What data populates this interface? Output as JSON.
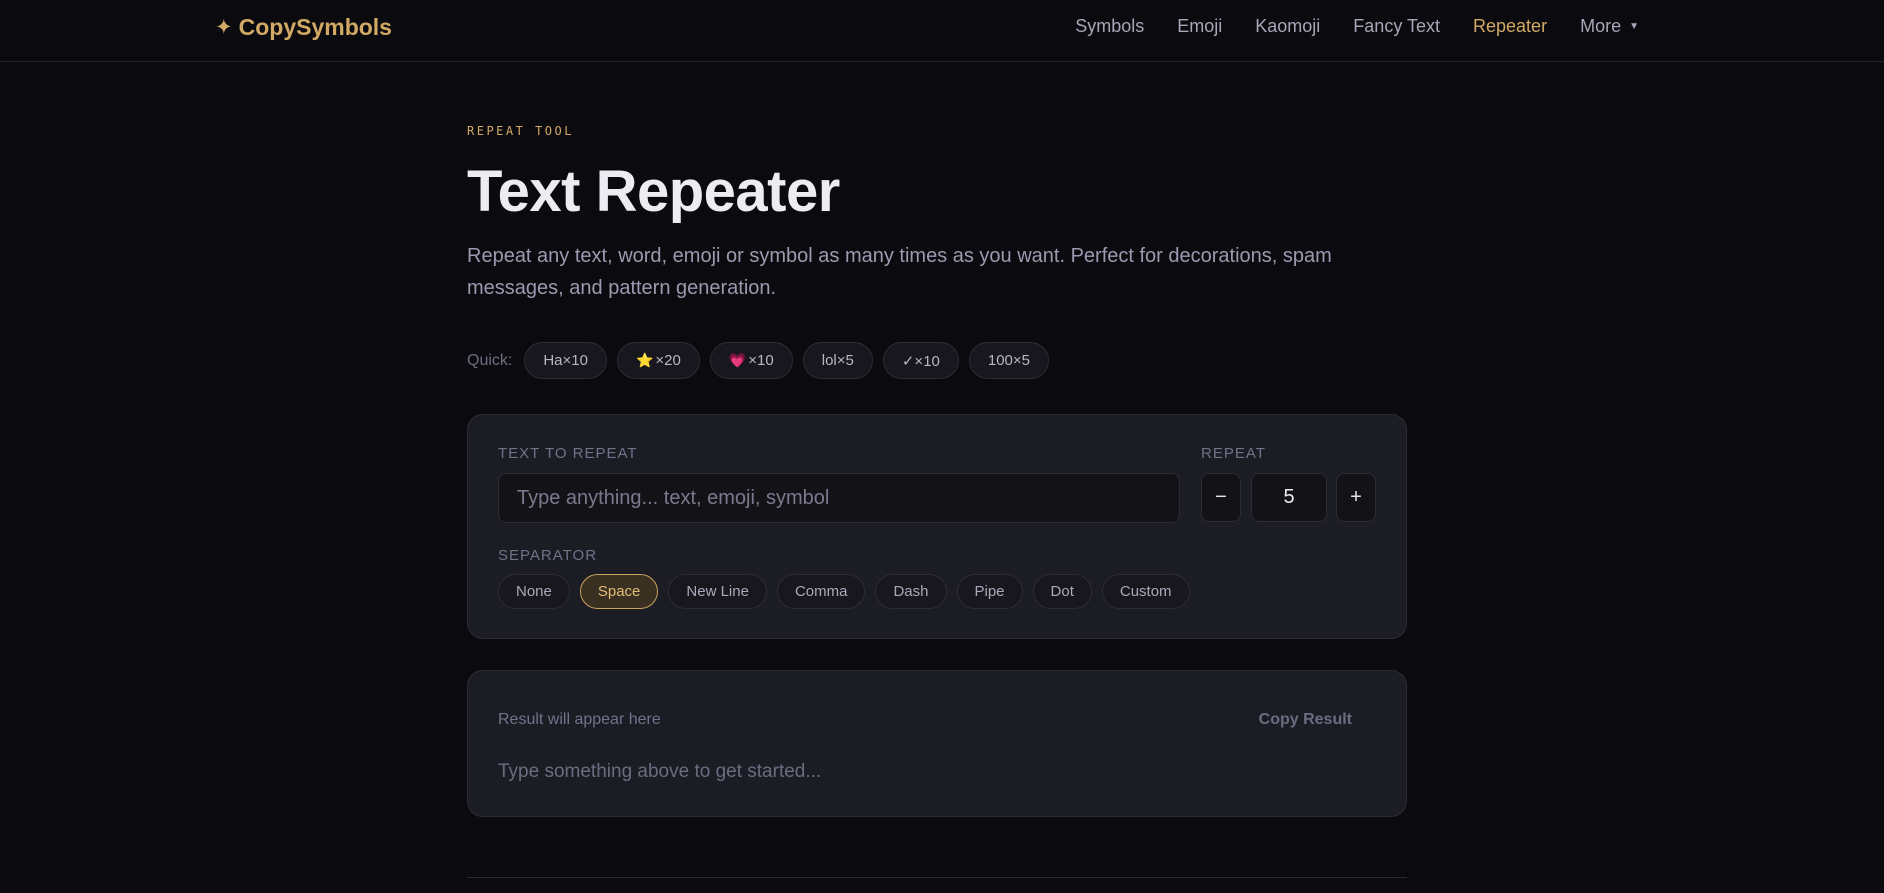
{
  "brand": {
    "star": "✦",
    "name": "CopySymbols"
  },
  "nav": {
    "items": [
      "Symbols",
      "Emoji",
      "Kaomoji",
      "Fancy Text",
      "Repeater"
    ],
    "active": "Repeater",
    "more_label": "More",
    "more_caret": "▼"
  },
  "hero": {
    "eyebrow": "REPEAT TOOL",
    "title": "Text Repeater",
    "description": "Repeat any text, word, emoji or symbol as many times as you want. Perfect for decorations, spam messages, and pattern generation."
  },
  "quick": {
    "label": "Quick:",
    "presets": [
      {
        "emoji": "",
        "text": "Ha×10"
      },
      {
        "emoji": "⭐",
        "text": "×20"
      },
      {
        "emoji": "💗",
        "text": "×10"
      },
      {
        "emoji": "",
        "text": "lol×5"
      },
      {
        "emoji": "",
        "text": "✓×10"
      },
      {
        "emoji": "",
        "text": "100×5"
      }
    ]
  },
  "editor": {
    "text_label": "TEXT TO REPEAT",
    "text_value": "",
    "text_placeholder": "Type anything... text, emoji, symbol",
    "repeat_label": "REPEAT",
    "minus_label": "−",
    "plus_label": "+",
    "repeat_count": "5",
    "separator_label": "SEPARATOR",
    "separators": [
      "None",
      "Space",
      "New Line",
      "Comma",
      "Dash",
      "Pipe",
      "Dot",
      "Custom"
    ],
    "active_separator": "Space"
  },
  "result": {
    "label": "Result will appear here",
    "copy_label": "Copy Result",
    "placeholder_text": "Type something above to get started..."
  },
  "colors": {
    "background": "#0b0b0f",
    "accent": "#d2a964",
    "card": "#1c1c24"
  }
}
